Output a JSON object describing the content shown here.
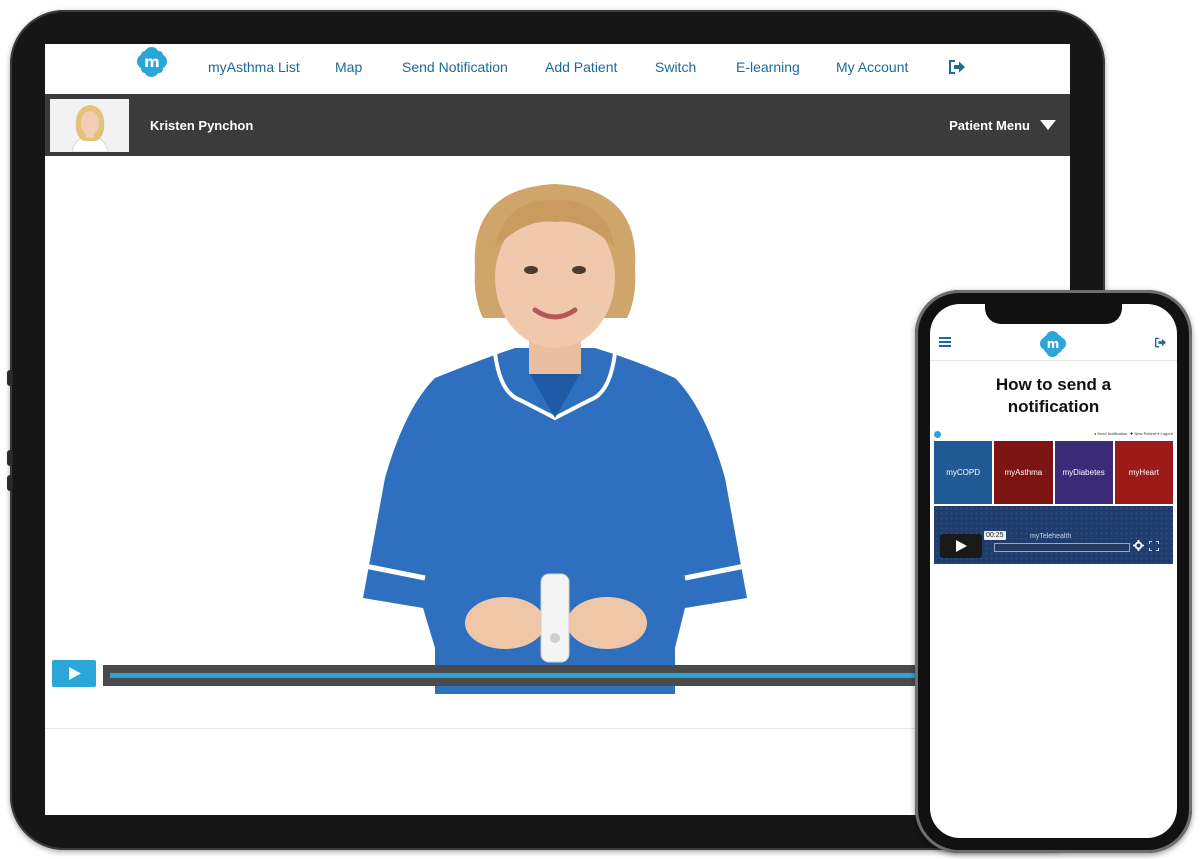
{
  "brand": {
    "logo_letter": "m",
    "accent_color": "#2aa6d9",
    "nav_text_color": "#1c6a9a"
  },
  "tablet": {
    "nav": {
      "items": [
        {
          "label": "myAsthma List"
        },
        {
          "label": "Map"
        },
        {
          "label": "Send Notification"
        },
        {
          "label": "Add Patient"
        },
        {
          "label": "Switch"
        },
        {
          "label": "E-learning"
        },
        {
          "label": "My Account"
        }
      ],
      "logout_icon": "sign-out-icon"
    },
    "patient_bar": {
      "name": "Kristen Pynchon",
      "menu_label": "Patient Menu",
      "bar_color": "#3b3b3b"
    },
    "video": {
      "progress": 1.0,
      "play_icon": "play-icon"
    }
  },
  "phone": {
    "title_line1": "How to send a",
    "title_line2": "notification",
    "mini_nav": [
      {
        "label": "◂ Send Notification"
      },
      {
        "label": "✚ New Patient"
      },
      {
        "label": "⇥ Logout"
      }
    ],
    "tiles": [
      {
        "label": "myCOPD",
        "color": "#1f5a94"
      },
      {
        "label": "myAsthma",
        "color": "#7d1414"
      },
      {
        "label": "myDiabetes",
        "color": "#3b2a78"
      },
      {
        "label": "myHeart",
        "color": "#9c1a1a"
      }
    ],
    "video": {
      "time": "00:25",
      "watermark": "myTelehealth",
      "progress": 0.0
    }
  }
}
